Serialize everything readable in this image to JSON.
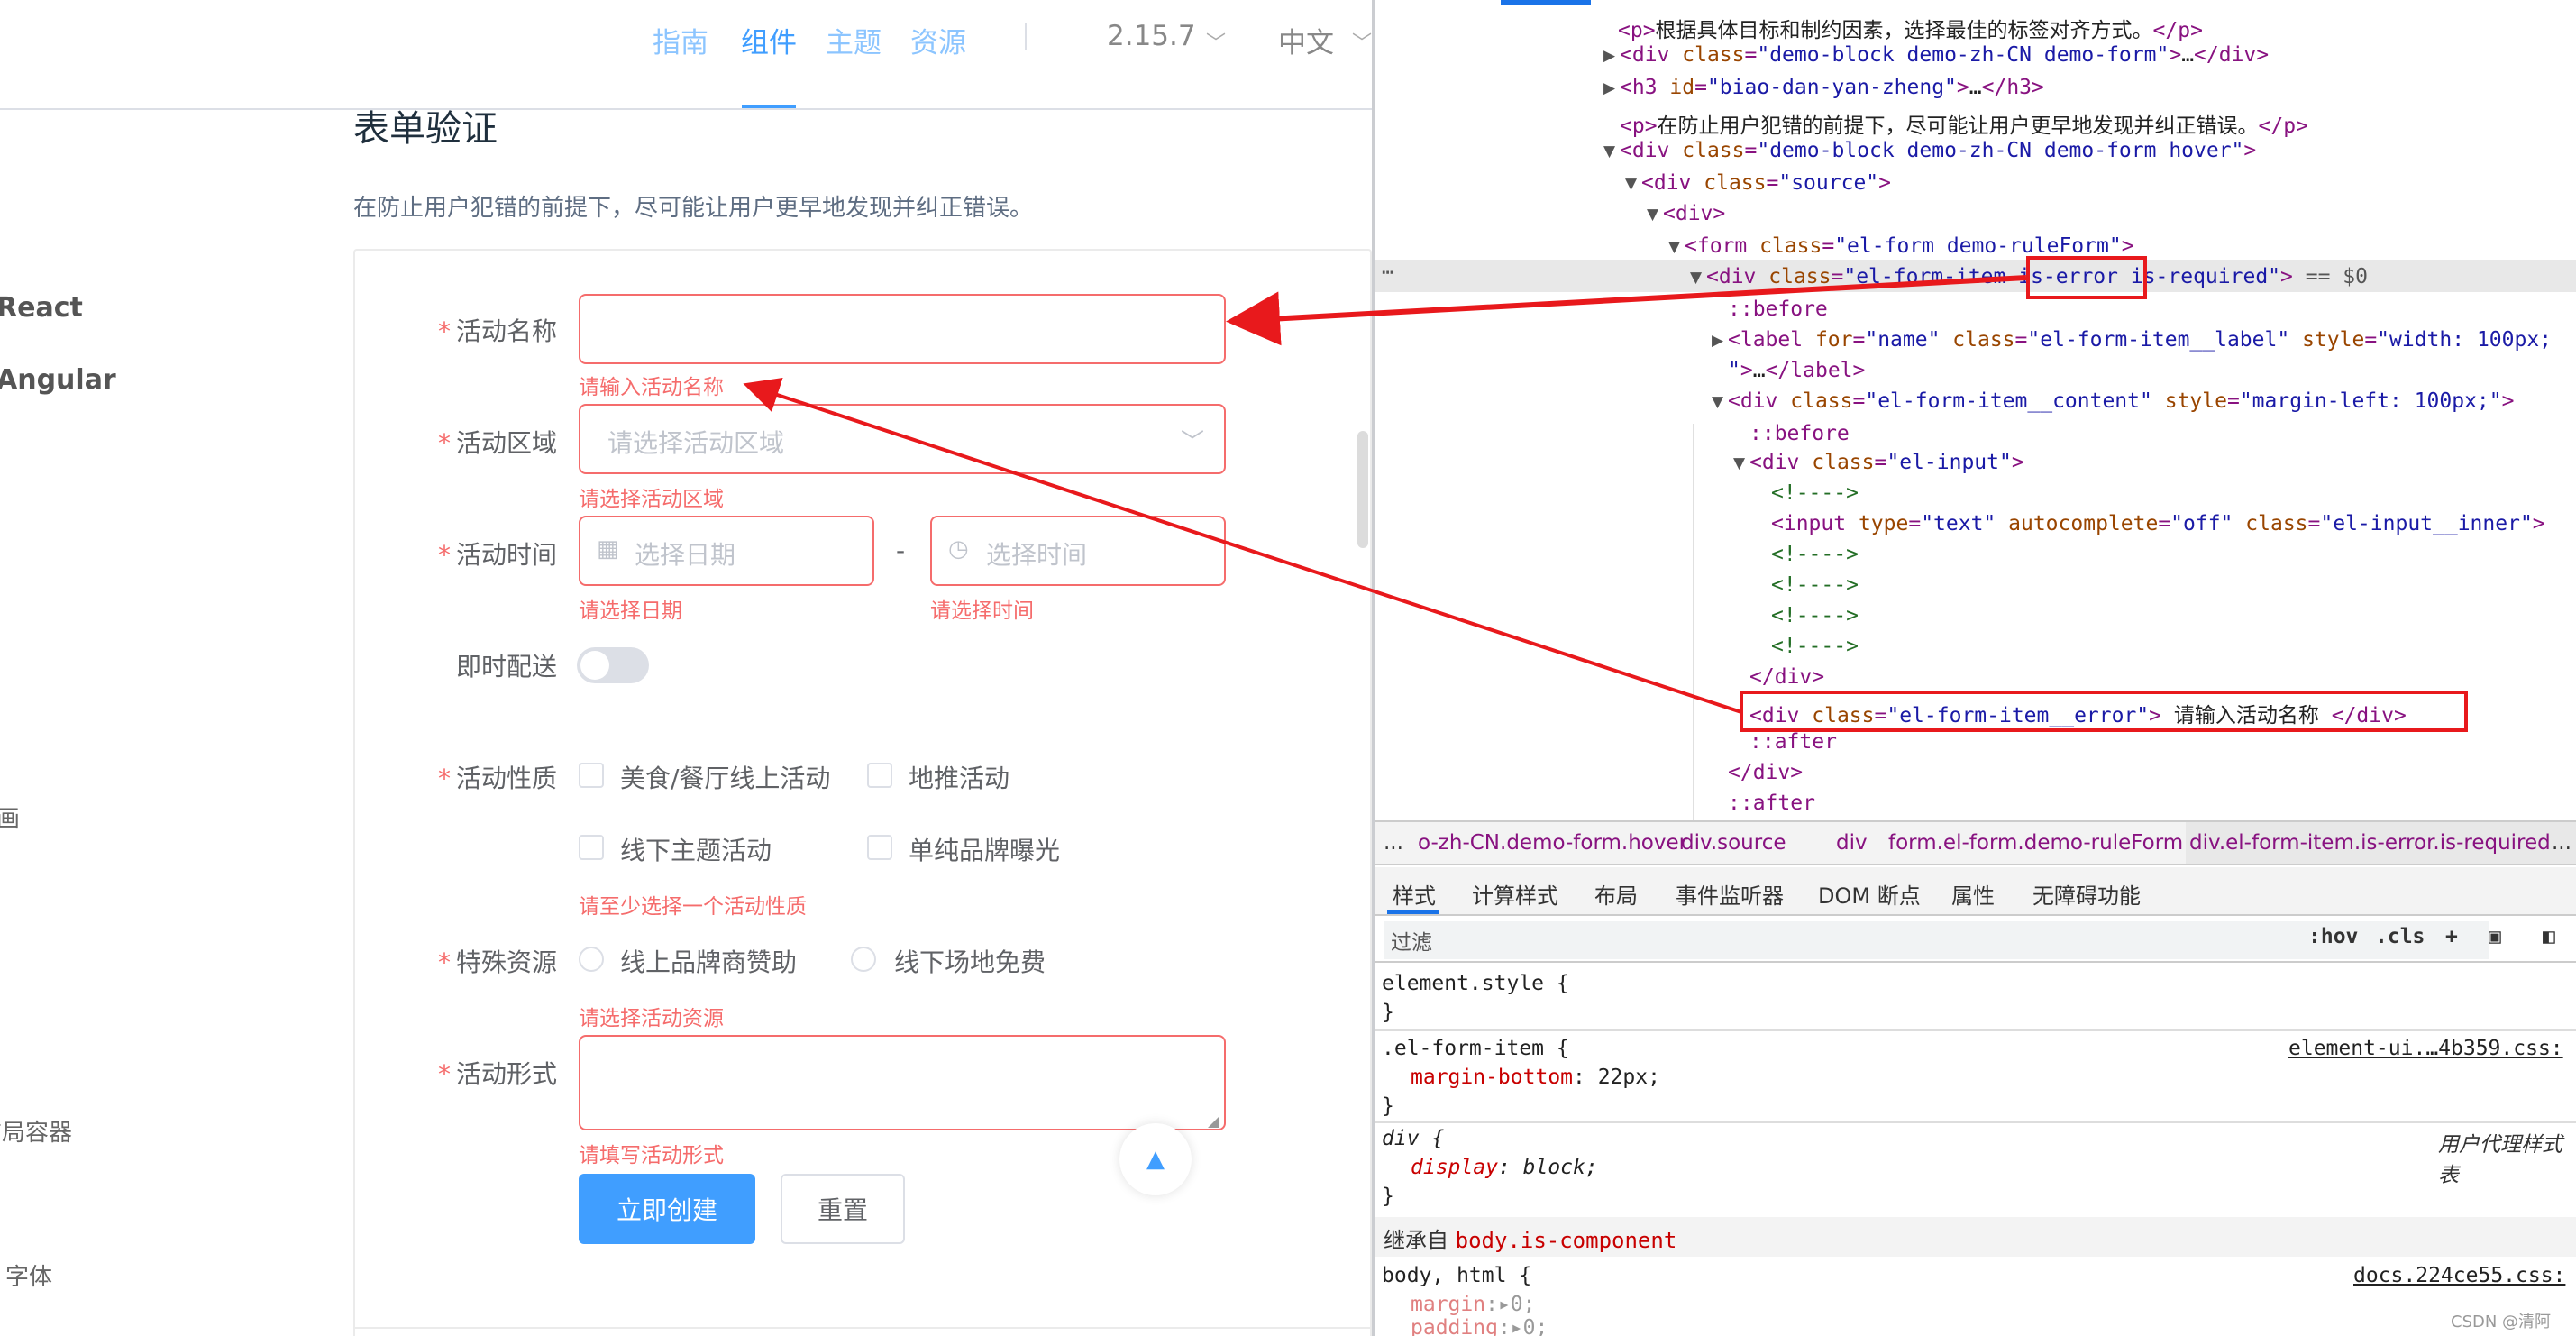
{
  "topnav": {
    "items": [
      "指南",
      "组件",
      "主题",
      "资源"
    ],
    "active_index": 1,
    "version": "2.15.7",
    "lang": "中文"
  },
  "sidebar": {
    "items": [
      "React",
      "Angular",
      "画",
      "布局容器",
      "字体"
    ]
  },
  "page": {
    "title": "表单验证",
    "desc": "在防止用户犯错的前提下，尽可能让用户更早地发现并纠正错误。"
  },
  "form": {
    "name_label": "活动名称",
    "name_error": "请输入活动名称",
    "region_label": "活动区域",
    "region_placeholder": "请选择活动区域",
    "region_error": "请选择活动区域",
    "time_label": "活动时间",
    "date_placeholder": "选择日期",
    "date_error": "请选择日期",
    "time_sep": "-",
    "time_placeholder": "选择时间",
    "time_error": "请选择时间",
    "delivery_label": "即时配送",
    "delivery_on": false,
    "type_label": "活动性质",
    "type_options": [
      "美食/餐厅线上活动",
      "地推活动",
      "线下主题活动",
      "单纯品牌曝光"
    ],
    "type_error": "请至少选择一个活动性质",
    "resource_label": "特殊资源",
    "resource_options": [
      "线上品牌商赞助",
      "线下场地免费"
    ],
    "resource_error": "请选择活动资源",
    "form_label": "活动形式",
    "form_error": "请填写活动形式",
    "create_button": "立即创建",
    "reset_button": "重置"
  },
  "devtools": {
    "breadcrumbs": [
      "...",
      "o-zh-CN.demo-form.hover",
      "div.source",
      "div",
      "form.el-form.demo-ruleForm",
      "div.el-form-item.is-error.is-required",
      "..."
    ],
    "tabs": [
      "样式",
      "计算样式",
      "布局",
      "事件监听器",
      "DOM 断点",
      "属性",
      "无障碍功能"
    ],
    "filter_label": "过滤",
    "filter_buttons": [
      ":hov",
      ".cls",
      "+"
    ],
    "element_style": "element.style {",
    "rule1_selector": ".el-form-item {",
    "rule1_prop": "margin-bottom",
    "rule1_value": ": 22px;",
    "rule1_src": "element-ui.…4b359.css:",
    "rule2_selector": "div {",
    "rule2_prop": "display",
    "rule2_value": ": block;",
    "rule2_src": "用户代理样式表",
    "close_brace": "}",
    "inherit_label": "继承自 ",
    "inherit_selector": "body.is-component",
    "rule3_selector": "body, html {",
    "rule3_src": "docs.224ce55.css:",
    "rule3_p1": "margin",
    "rule3_p1v": ":▸0;",
    "rule3_p2": "padding",
    "rule3_p2v": ":▸0;",
    "dom_equals": " == $0",
    "watermark": "CSDN @清阿哥、"
  },
  "colors": {
    "primary": "#409eff",
    "error": "#f56c6c",
    "annotation": "#e8191c"
  }
}
